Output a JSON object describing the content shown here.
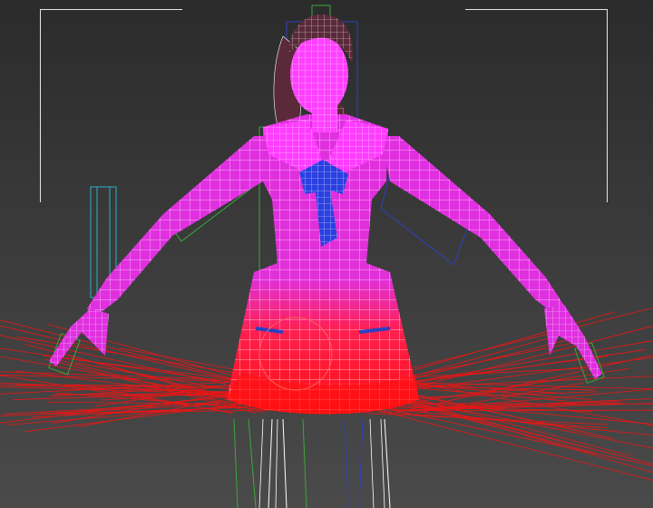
{
  "viewport": {
    "background_top": "#2b2b2b",
    "background_bottom": "#4a4a4a"
  },
  "model": {
    "wire_color": "#ffffff",
    "body_color": "#e030e0",
    "skirt_color": "#ff1010",
    "ribbon_color": "#2a40e0",
    "hair_color": "#5a2a3a",
    "face_color": "#ff40ff",
    "bone_green": "#3aa83a",
    "bone_cyan": "#2ab0c8",
    "bone_blue": "#3040c0",
    "cloth_rays": "#ff1010"
  },
  "icons": {
    "viewport_corner_brackets": "selection-bracket-icon"
  }
}
